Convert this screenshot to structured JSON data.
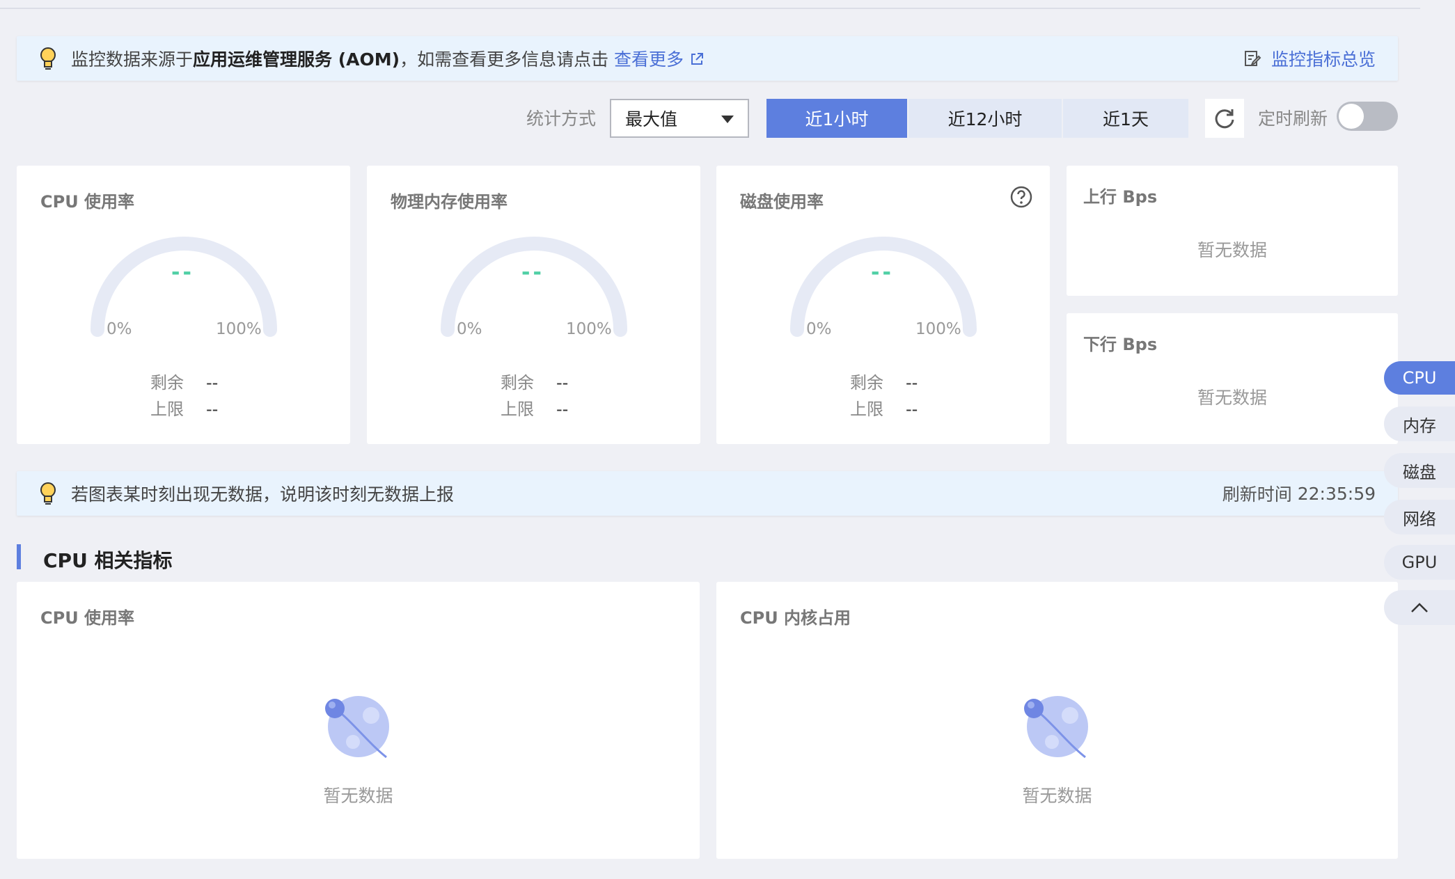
{
  "banner_top": {
    "text_prefix": "监控数据来源于",
    "text_bold": "应用运维管理服务 (AOM)",
    "text_suffix": "，如需查看更多信息请点击",
    "more_link": "查看更多",
    "overview_link": "监控指标总览"
  },
  "toolbar": {
    "stat_label": "统计方式",
    "stat_value": "最大值",
    "ranges": [
      "近1小时",
      "近12小时",
      "近1天"
    ],
    "active_range": "近1小时",
    "auto_refresh_label": "定时刷新",
    "auto_refresh_on": false
  },
  "gauges": [
    {
      "title": "CPU 使用率",
      "value": "--",
      "min": "0%",
      "max": "100%",
      "remain_label": "剩余",
      "remain_value": "--",
      "limit_label": "上限",
      "limit_value": "--"
    },
    {
      "title": "物理内存使用率",
      "value": "--",
      "min": "0%",
      "max": "100%",
      "remain_label": "剩余",
      "remain_value": "--",
      "limit_label": "上限",
      "limit_value": "--"
    },
    {
      "title": "磁盘使用率",
      "value": "--",
      "min": "0%",
      "max": "100%",
      "remain_label": "剩余",
      "remain_value": "--",
      "limit_label": "上限",
      "limit_value": "--"
    }
  ],
  "net": [
    {
      "title": "上行 Bps",
      "empty": "暂无数据"
    },
    {
      "title": "下行 Bps",
      "empty": "暂无数据"
    }
  ],
  "banner_mid": {
    "text": "若图表某时刻出现无数据，说明该时刻无数据上报",
    "refresh_label": "刷新时间",
    "refresh_time": "22:35:59"
  },
  "section": {
    "title": "CPU 相关指标"
  },
  "charts": [
    {
      "title": "CPU 使用率",
      "empty": "暂无数据"
    },
    {
      "title": "CPU 内核占用",
      "empty": "暂无数据"
    }
  ],
  "side_nav": [
    "CPU",
    "内存",
    "磁盘",
    "网络",
    "GPU"
  ],
  "colors": {
    "accent": "#5d7fdf",
    "gauge_value": "#4fcfa5",
    "banner_bg": "#e9f3fd"
  }
}
